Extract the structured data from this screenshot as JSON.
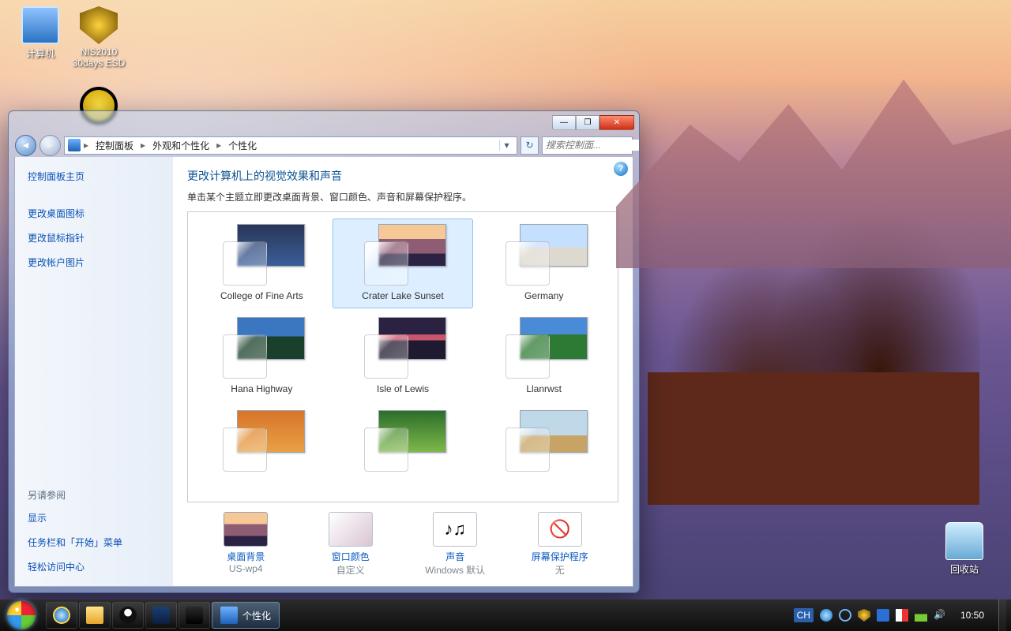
{
  "desktop_icons": {
    "computer": "计算机",
    "nis": "NIS2010 30days ESD",
    "recycle": "回收站"
  },
  "window": {
    "controls": {
      "min": "—",
      "max": "❐",
      "close": "✕"
    },
    "nav_back": "◄",
    "nav_fwd": "►",
    "breadcrumb": [
      "控制面板",
      "外观和个性化",
      "个性化"
    ],
    "refresh": "↻",
    "search_placeholder": "搜索控制面...",
    "help": "?"
  },
  "sidebar": {
    "home": "控制面板主页",
    "links": [
      "更改桌面图标",
      "更改鼠标指针",
      "更改帐户图片"
    ],
    "see_also_hdr": "另请参阅",
    "see_also": [
      "显示",
      "任务栏和「开始」菜单",
      "轻松访问中心"
    ]
  },
  "main": {
    "title": "更改计算机上的视觉效果和声音",
    "subtitle": "单击某个主题立即更改桌面背景、窗口颜色、声音和屏幕保护程序。"
  },
  "themes": [
    {
      "name": "College of Fine Arts",
      "img": "i-college",
      "sw": "sw-tan",
      "selected": false
    },
    {
      "name": "Crater Lake Sunset",
      "img": "i-crater",
      "sw": "sw-mauve",
      "selected": true
    },
    {
      "name": "Germany",
      "img": "i-germany",
      "sw": "sw-grey",
      "selected": false
    },
    {
      "name": "Hana Highway",
      "img": "i-hana",
      "sw": "sw-green",
      "selected": false
    },
    {
      "name": "Isle of Lewis",
      "img": "i-lewis",
      "sw": "sw-mauve",
      "selected": false
    },
    {
      "name": "Llanrwst",
      "img": "i-llan",
      "sw": "sw-green",
      "selected": false
    },
    {
      "name": "",
      "img": "i-row3a",
      "sw": "sw-tan",
      "selected": false
    },
    {
      "name": "",
      "img": "i-row3b",
      "sw": "sw-green",
      "selected": false
    },
    {
      "name": "",
      "img": "i-row3c",
      "sw": "sw-grey",
      "selected": false
    }
  ],
  "bottom": [
    {
      "title": "桌面背景",
      "value": "US-wp4",
      "ico": "ico-wall"
    },
    {
      "title": "窗口颜色",
      "value": "自定义",
      "ico": "ico-color"
    },
    {
      "title": "声音",
      "value": "Windows 默认",
      "glyph": "♪♫"
    },
    {
      "title": "屏幕保护程序",
      "value": "无",
      "glyph": "🚫"
    }
  ],
  "taskbar": {
    "active_label": "个性化",
    "lang": "CH",
    "clock": "10:50"
  }
}
